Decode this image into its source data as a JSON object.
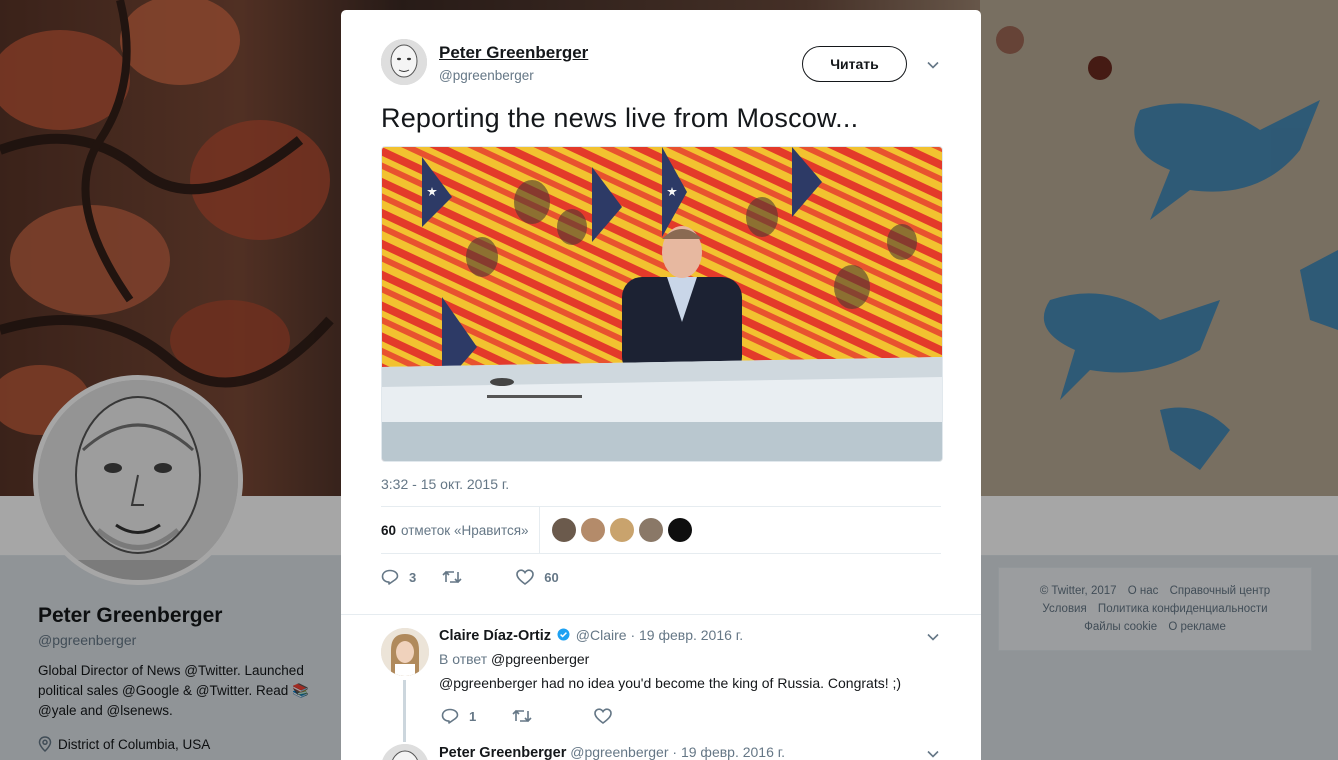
{
  "profile": {
    "name": "Peter Greenberger",
    "handle": "@pgreenberger",
    "bio": "Global Director of News @Twitter. Launched political sales @Google & @Twitter. Read 📚 @yale and @lsenews.",
    "location": "District of Columbia, USA"
  },
  "footer": {
    "links": [
      "© Twitter, 2017",
      "О нас",
      "Справочный центр",
      "Условия",
      "Политика конфиденциальности",
      "Файлы cookie",
      "О рекламе"
    ]
  },
  "tweet": {
    "author_name": "Peter Greenberger",
    "author_handle": "@pgreenberger",
    "follow_label": "Читать",
    "text": "Reporting the news live from Moscow...",
    "timestamp": "3:32 - 15 окт. 2015 г.",
    "likes_count": "60",
    "likes_label": "отметок «Нравится»",
    "likers_colors": [
      "#6b5a4c",
      "#b48b6a",
      "#c9a36d",
      "#8a7867",
      "#0e0e0e"
    ],
    "replies": "3",
    "retweets": "",
    "likes": "60"
  },
  "replies": [
    {
      "name": "Claire Díaz-Ortiz",
      "verified": true,
      "handle": "@Claire",
      "date": "· 19 февр. 2016 г.",
      "in_reply_prefix": "В ответ",
      "in_reply_to": "@pgreenberger",
      "text": "@pgreenberger had no idea you'd become the king of Russia. Congrats! ;)",
      "reply_count": "1"
    },
    {
      "name": "Peter Greenberger",
      "handle": "@pgreenberger",
      "date": "· 19 февр. 2016 г."
    }
  ],
  "colors": {
    "accent": "#1da1f2",
    "muted": "#657786",
    "text": "#14171a"
  }
}
